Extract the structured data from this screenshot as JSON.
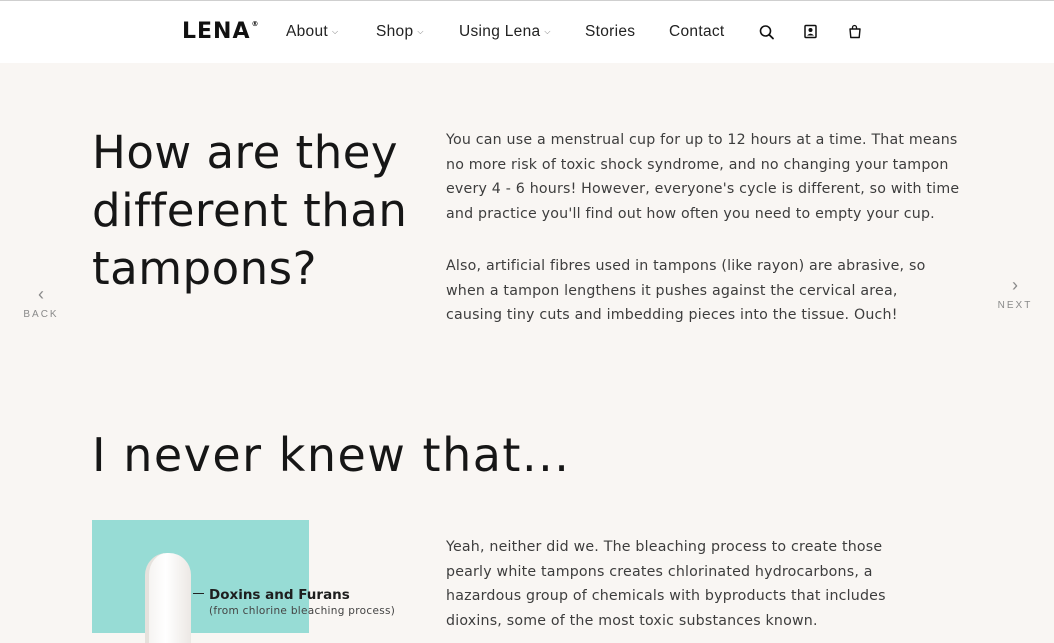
{
  "header": {
    "logo": "LENA",
    "logo_mark": "®",
    "nav": [
      {
        "label": "About",
        "dropdown": true
      },
      {
        "label": "Shop",
        "dropdown": true
      },
      {
        "label": "Using Lena",
        "dropdown": true
      },
      {
        "label": "Stories",
        "dropdown": false
      },
      {
        "label": "Contact",
        "dropdown": false
      }
    ],
    "dropdown_glyph": "⌵",
    "icons": [
      "search-icon",
      "account-icon",
      "cart-icon"
    ]
  },
  "section1": {
    "heading_lines": [
      "How are they",
      "different than",
      "tampons?"
    ],
    "paragraph1_lines": [
      "You can use a menstrual cup for up to 12 hours at a time. That means",
      "no more risk of toxic shock syndrome, and no changing your tampon",
      "every 4 - 6 hours! However, everyone's cycle is different, so with time",
      "and practice you'll find out how often you need to empty your cup."
    ],
    "paragraph2_lines": [
      "Also, artificial fibres used in tampons (like rayon) are abrasive, so",
      "when a tampon lengthens it pushes against the cervical area,",
      "causing tiny cuts and imbedding pieces into the tissue. Ouch!"
    ]
  },
  "carousel": {
    "back_label": "BACK",
    "next_label": "NEXT",
    "back_glyph": "‹",
    "next_glyph": "›"
  },
  "section2": {
    "heading": "I never knew that...",
    "callout_title": "Doxins and Furans",
    "callout_sub": "(from chlorine bleaching process)",
    "paragraph_lines": [
      "Yeah, neither did we. The bleaching process to create those",
      "pearly white tampons creates chlorinated hydrocarbons, a",
      "hazardous group of chemicals with byproducts that includes",
      "dioxins, some of the most toxic substances known."
    ]
  },
  "colors": {
    "page_bg": "#f9f6f3",
    "promo_bg": "#97dcd5",
    "text_dark": "#161616",
    "text_body": "#3d3d3d"
  }
}
